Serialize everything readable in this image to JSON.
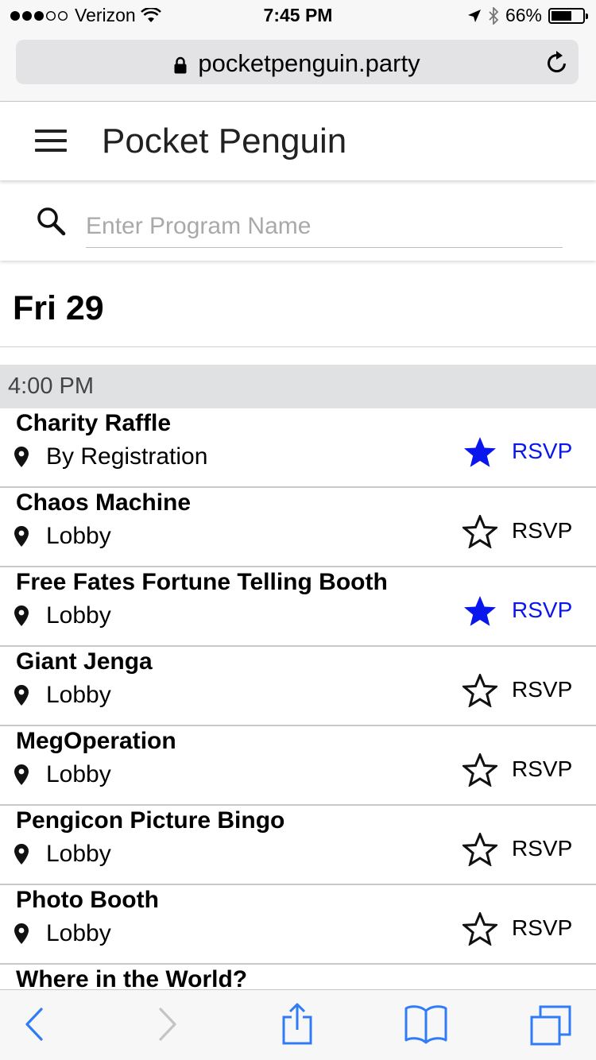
{
  "status_bar": {
    "carrier": "Verizon",
    "time": "7:45 PM",
    "battery": "66%",
    "battery_level": 0.66
  },
  "browser": {
    "url": "pocketpenguin.party"
  },
  "app": {
    "title": "Pocket Penguin"
  },
  "search": {
    "placeholder": "Enter Program Name",
    "value": ""
  },
  "schedule": {
    "date": "Fri 29",
    "time_slot": "4:00 PM",
    "events": [
      {
        "name": "Charity Raffle",
        "location": "By Registration",
        "starred": true,
        "rsvp": "RSVP"
      },
      {
        "name": "Chaos Machine",
        "location": "Lobby",
        "starred": false,
        "rsvp": "RSVP"
      },
      {
        "name": "Free Fates Fortune Telling Booth",
        "location": "Lobby",
        "starred": true,
        "rsvp": "RSVP"
      },
      {
        "name": "Giant Jenga",
        "location": "Lobby",
        "starred": false,
        "rsvp": "RSVP"
      },
      {
        "name": "MegOperation",
        "location": "Lobby",
        "starred": false,
        "rsvp": "RSVP"
      },
      {
        "name": "Pengicon Picture Bingo",
        "location": "Lobby",
        "starred": false,
        "rsvp": "RSVP"
      },
      {
        "name": "Photo Booth",
        "location": "Lobby",
        "starred": false,
        "rsvp": "RSVP"
      },
      {
        "name": "Where in the World?",
        "location": "",
        "starred": false,
        "rsvp": ""
      }
    ]
  },
  "colors": {
    "accent_blue": "#0a16ee",
    "toolbar_blue": "#2f7cf6",
    "time_slot_bg": "#dfe1e3"
  },
  "icons": {
    "back": "chevron-left-icon",
    "forward": "chevron-right-icon",
    "share": "share-icon",
    "bookmarks": "book-icon",
    "tabs": "tabs-icon",
    "menu": "hamburger-menu-icon",
    "search": "search-icon",
    "location": "location-pin-icon",
    "favorite": "star-icon"
  }
}
